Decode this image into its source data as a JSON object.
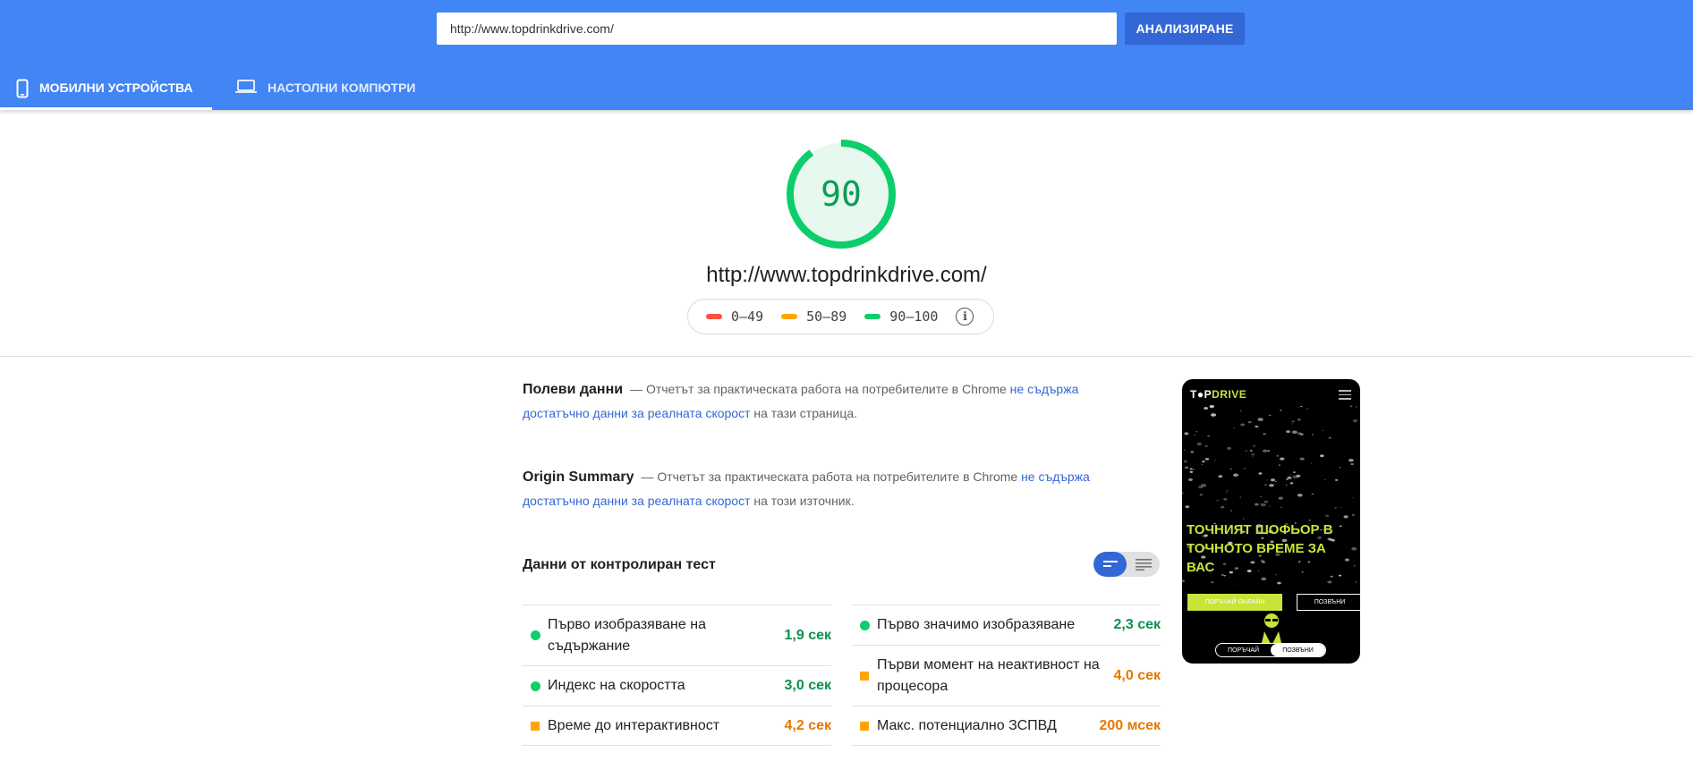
{
  "header": {
    "url_value": "http://www.topdrinkdrive.com/",
    "analyze_label": "АНАЛИЗИРАНЕ",
    "tabs": [
      {
        "label": "МОБИЛНИ УСТРОЙСТВА",
        "active": true,
        "icon": "smartphone-icon"
      },
      {
        "label": "НАСТОЛНИ КОМПЮТРИ",
        "active": false,
        "icon": "laptop-icon"
      }
    ]
  },
  "score": {
    "value": "90",
    "value_fraction": 0.9,
    "url": "http://www.topdrinkdrive.com/",
    "color": "#0cce6b"
  },
  "legend": [
    {
      "label": "0–49",
      "color": "#ff4e42"
    },
    {
      "label": "50–89",
      "color": "#ffa400"
    },
    {
      "label": "90–100",
      "color": "#0cce6b"
    }
  ],
  "field_data": {
    "title": "Полеви данни",
    "text_before": "— Отчетът за практическата работа на потребителите в Chrome ",
    "link": "не съдържа достатъчно данни за реалната скорост",
    "text_after": " на тази страница."
  },
  "origin_summary": {
    "title": "Origin Summary",
    "text_before": "— Отчетът за практическата работа на потребителите в Chrome ",
    "link": "не съдържа достатъчно данни за реалната скорост",
    "text_after": " на този източник."
  },
  "lab": {
    "title": "Данни от контролиран тест",
    "left_metrics": [
      {
        "name": "Първо изобразяване на съдържание",
        "value": "1,9 сек",
        "status": "good"
      },
      {
        "name": "Индекс на скоростта",
        "value": "3,0 сек",
        "status": "good"
      },
      {
        "name": "Време до интерактивност",
        "value": "4,2 сек",
        "status": "average"
      }
    ],
    "right_metrics": [
      {
        "name": "Първо значимо изобразяване",
        "value": "2,3 сек",
        "status": "good"
      },
      {
        "name": "Първи момент на неактивност на процесора",
        "value": "4,0 сек",
        "status": "average"
      },
      {
        "name": "Макс. потенциално ЗСПВД",
        "value": "200 мсек",
        "status": "average"
      }
    ]
  },
  "screenshot": {
    "logo_prefix": "T",
    "logo_mid": "P",
    "logo_brand": "DRIVE",
    "headline": "ТОЧНИЯТ ШОФЬОР В ТОЧНОТО ВРЕМЕ ЗА ВАС",
    "primary_button": "ПОРЪЧАЙ ОНЛАЙН",
    "secondary_button": "ПОЗВЪНИ",
    "bottom_order": "ПОРЪЧАЙ",
    "bottom_call": "ПОЗВЪНИ"
  }
}
